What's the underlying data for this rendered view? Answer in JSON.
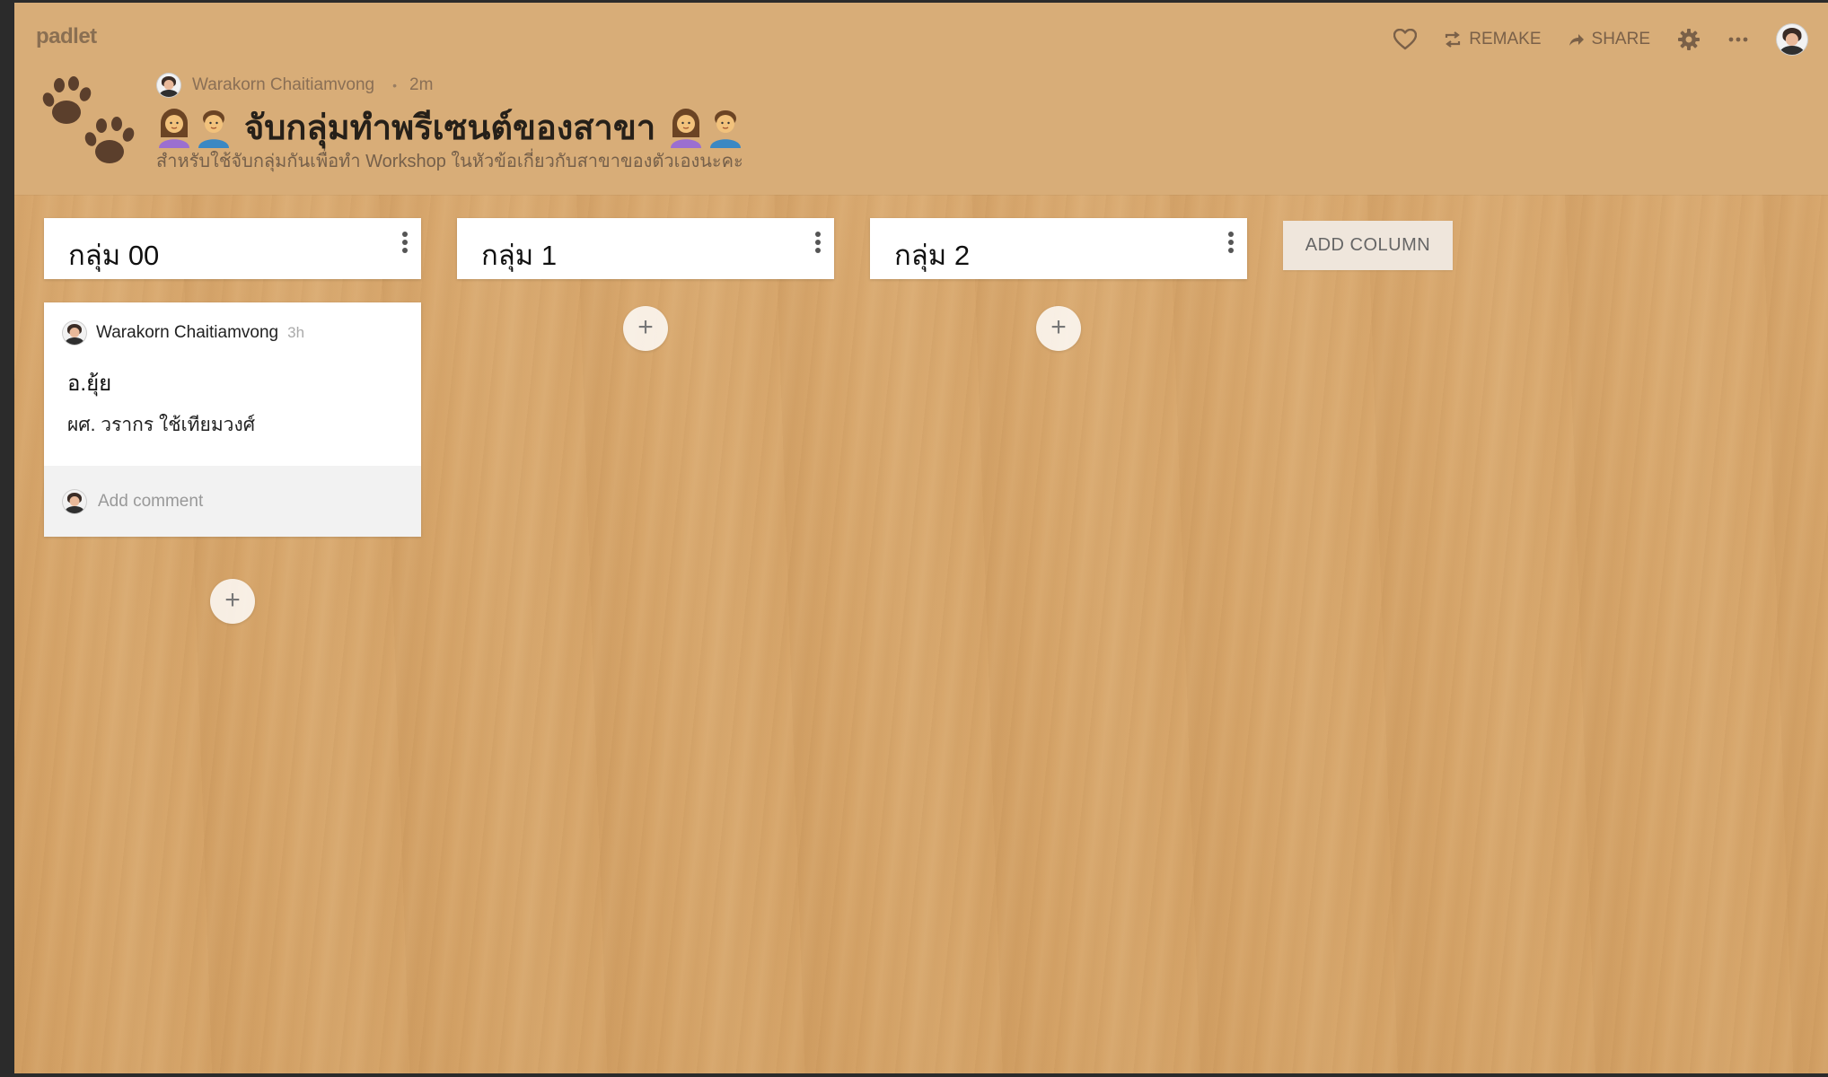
{
  "app": {
    "brand": "padlet"
  },
  "toolbar": {
    "like_icon": "heart-icon",
    "remake_label": "REMAKE",
    "share_label": "SHARE",
    "settings_icon": "gear-icon",
    "more_icon": "ellipsis-icon"
  },
  "board": {
    "author": "Warakorn Chaitiamvong",
    "separator": "•",
    "time": "2m",
    "title": "จับกลุ่มทำพรีเซนต์ของสาขา",
    "subtitle": "สำหรับใช้จับกลุ่มกันเพื่อทำ Workshop ในหัวข้อเกี่ยวกับสาขาของตัวเองนะคะ",
    "icon": "paw-prints-icon"
  },
  "columns": [
    {
      "title": "กลุ่ม 00"
    },
    {
      "title": "กลุ่ม 1"
    },
    {
      "title": "กลุ่ม 2"
    }
  ],
  "add_column_label": "ADD COLUMN",
  "post": {
    "author": "Warakorn Chaitiamvong",
    "time": "3h",
    "title": "อ.ยุ้ย",
    "body": "ผศ. วรากร ใช้เทียมวงศ์",
    "comment_placeholder": "Add comment"
  },
  "add_post_symbol": "+",
  "colors": {
    "header_bg": "#d8ad78",
    "wood_bg": "#d7a66b",
    "card_bg": "#ffffff",
    "text_dark": "#262019"
  }
}
